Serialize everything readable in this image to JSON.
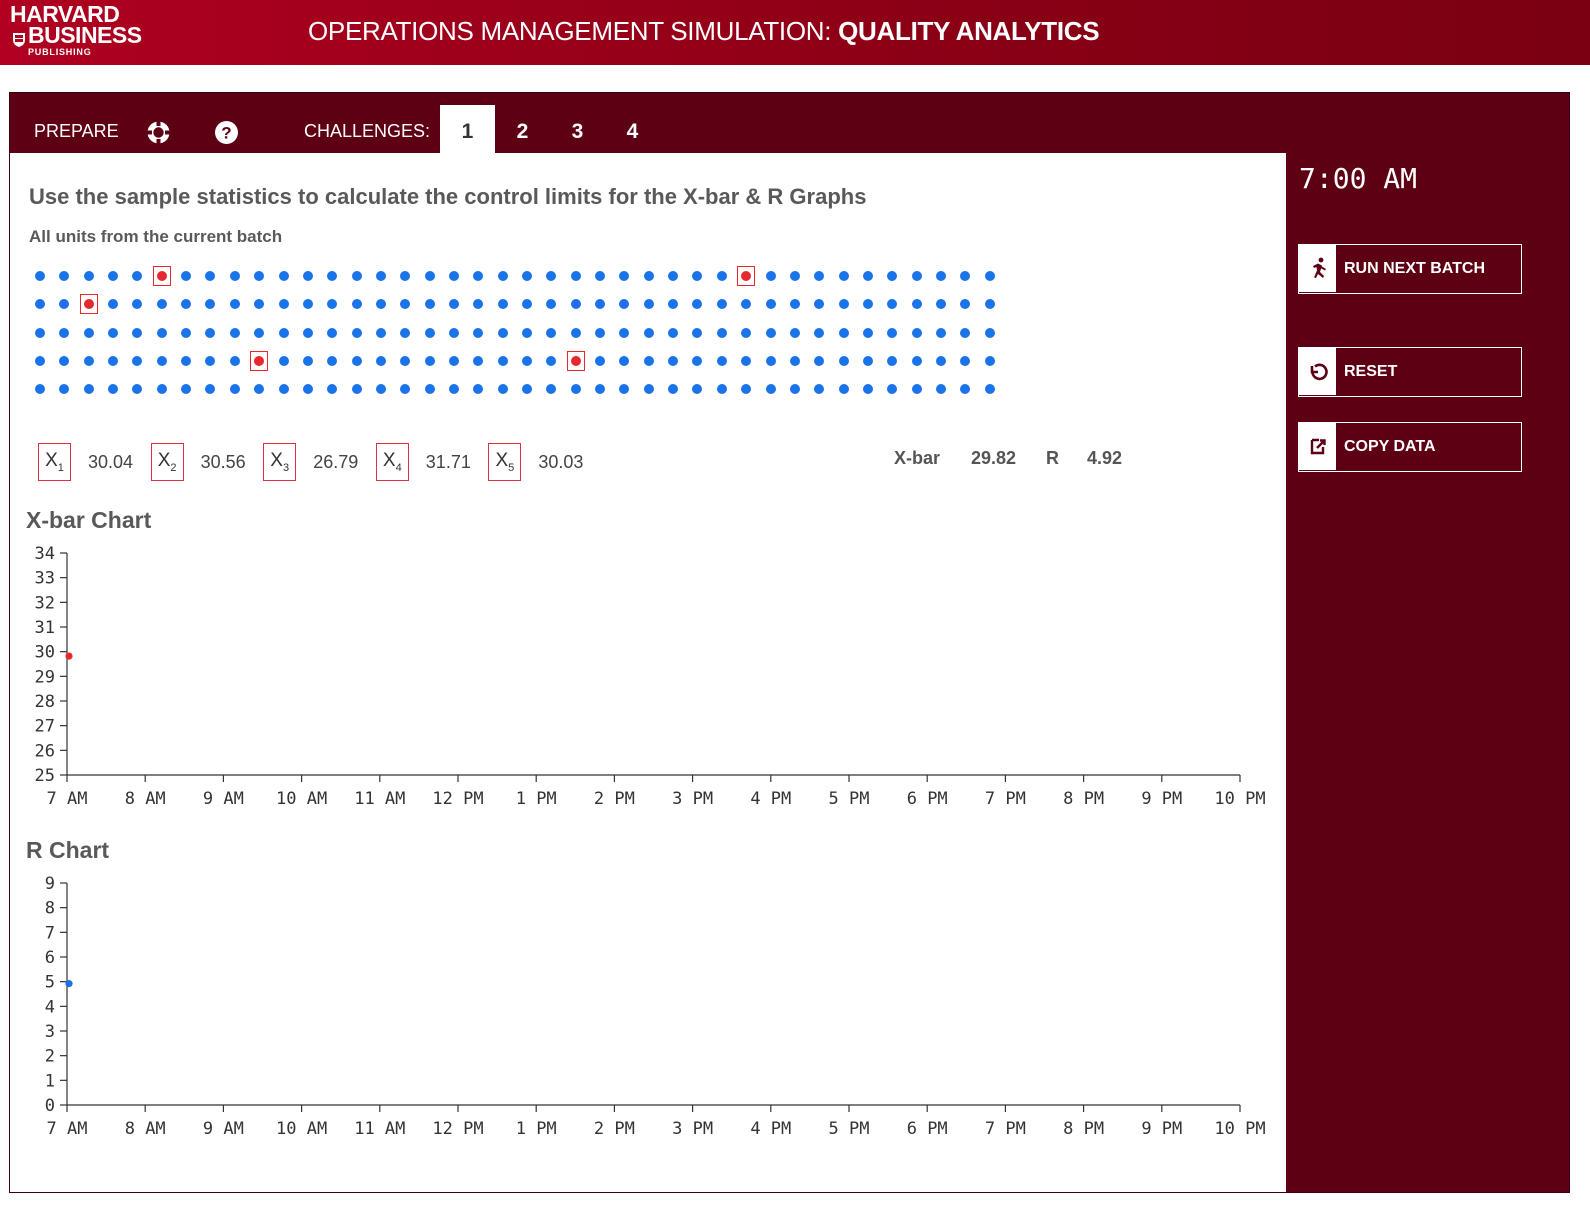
{
  "header": {
    "logo_line1": "HARVARD",
    "logo_line2": "BUSINESS",
    "logo_line3": "PUBLISHING",
    "title_prefix": "OPERATIONS MANAGEMENT SIMULATION:",
    "title_bold": "QUALITY ANALYTICS"
  },
  "nav": {
    "prepare": "PREPARE",
    "challenges_label": "CHALLENGES:",
    "tabs": [
      "1",
      "2",
      "3",
      "4"
    ],
    "active_tab": "1"
  },
  "main": {
    "instruction": "Use the sample statistics to calculate the control limits for the X-bar & R Graphs",
    "subtitle": "All units from the current batch"
  },
  "batch_grid": {
    "rows": 5,
    "cols": 40,
    "selected": [
      [
        0,
        5
      ],
      [
        0,
        29
      ],
      [
        1,
        2
      ],
      [
        3,
        9
      ],
      [
        3,
        22
      ]
    ]
  },
  "samples": [
    {
      "label": "X",
      "sub": "1",
      "value": "30.04"
    },
    {
      "label": "X",
      "sub": "2",
      "value": "30.56"
    },
    {
      "label": "X",
      "sub": "3",
      "value": "26.79"
    },
    {
      "label": "X",
      "sub": "4",
      "value": "31.71"
    },
    {
      "label": "X",
      "sub": "5",
      "value": "30.03"
    }
  ],
  "stats": {
    "xbar_label": "X-bar",
    "xbar_value": "29.82",
    "r_label": "R",
    "r_value": "4.92"
  },
  "xbar_chart": {
    "title": "X-bar Chart",
    "y_ticks": [
      25,
      26,
      27,
      28,
      29,
      30,
      31,
      32,
      33,
      34
    ],
    "ylim": [
      25,
      34
    ],
    "x_ticks": [
      "7 AM",
      "8 AM",
      "9 AM",
      "10 AM",
      "11 AM",
      "12 PM",
      "1 PM",
      "2 PM",
      "3 PM",
      "4 PM",
      "5 PM",
      "6 PM",
      "7 PM",
      "8 PM",
      "9 PM",
      "10 PM"
    ],
    "point_color": "#e8282e",
    "points": [
      {
        "x": 0,
        "y": 29.82
      }
    ]
  },
  "r_chart": {
    "title": "R Chart",
    "y_ticks": [
      0,
      1,
      2,
      3,
      4,
      5,
      6,
      7,
      8,
      9
    ],
    "ylim": [
      0,
      9
    ],
    "x_ticks": [
      "7 AM",
      "8 AM",
      "9 AM",
      "10 AM",
      "11 AM",
      "12 PM",
      "1 PM",
      "2 PM",
      "3 PM",
      "4 PM",
      "5 PM",
      "6 PM",
      "7 PM",
      "8 PM",
      "9 PM",
      "10 PM"
    ],
    "point_color": "#1a73e8",
    "points": [
      {
        "x": 0,
        "y": 4.92
      }
    ]
  },
  "sidebar": {
    "clock": "7:00 AM",
    "run_label": "RUN NEXT BATCH",
    "reset_label": "RESET",
    "copy_label": "COPY DATA"
  },
  "colors": {
    "brand_red": "#b00020",
    "panel_maroon": "#5e0014",
    "dot_blue": "#1a73e8",
    "dot_red": "#e8282e"
  }
}
